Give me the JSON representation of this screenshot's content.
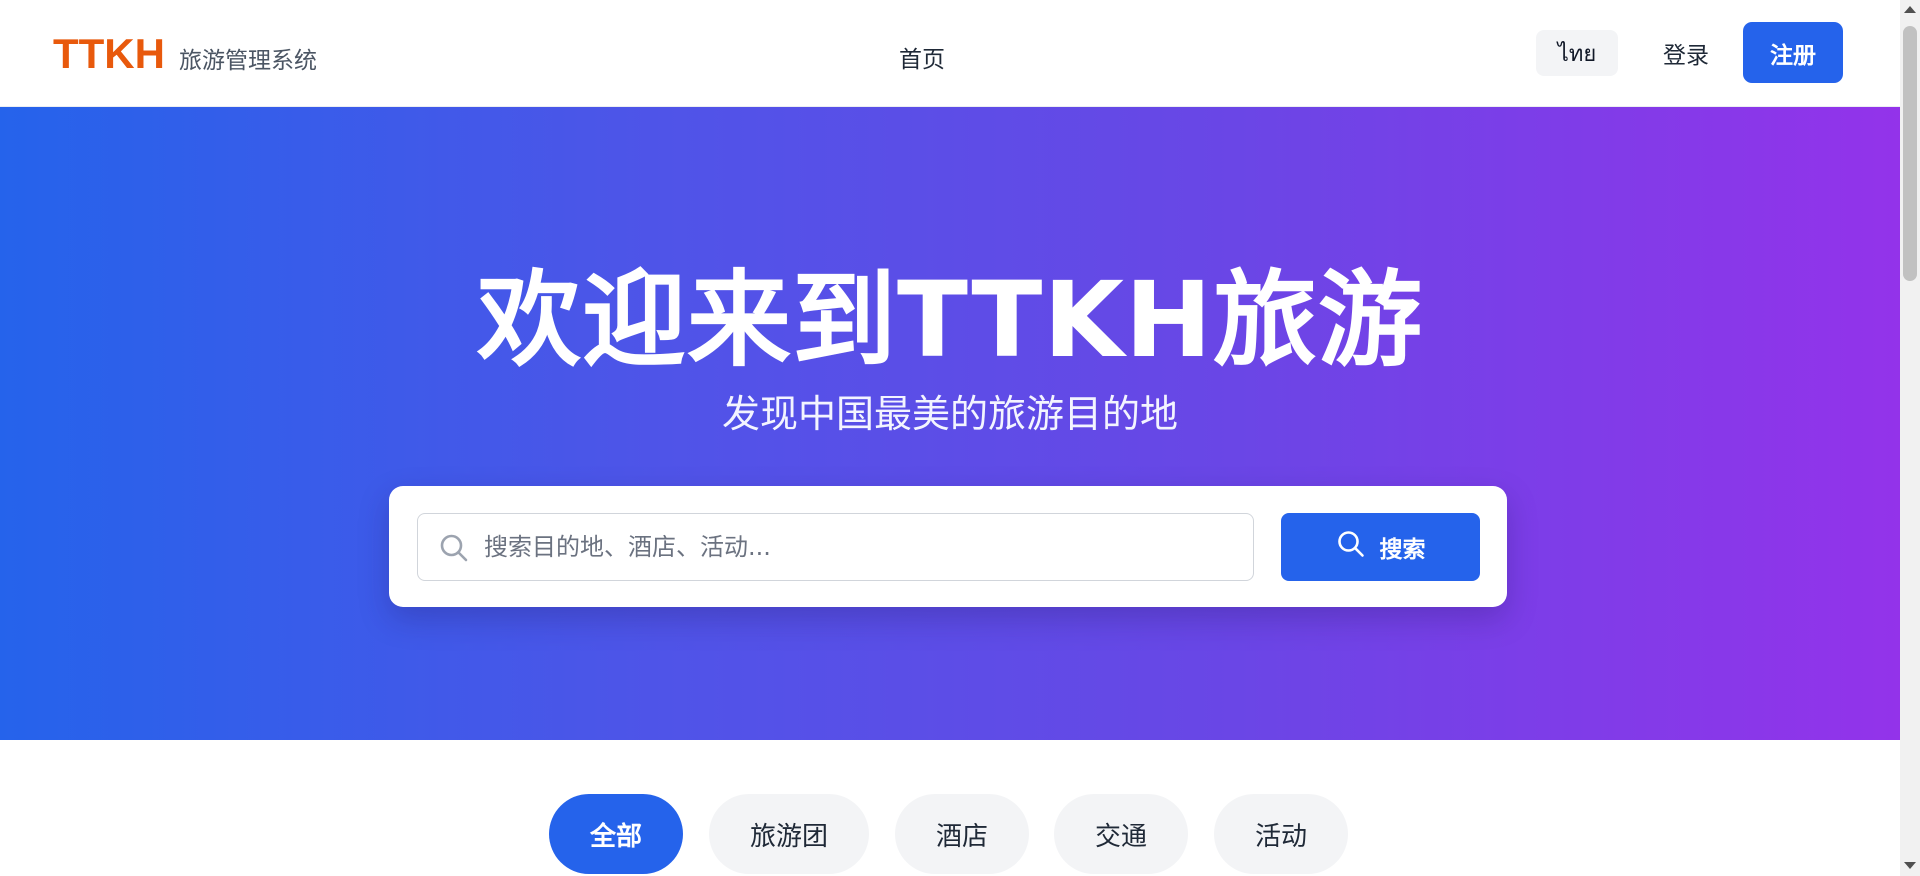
{
  "header": {
    "logo_text": "TTKH",
    "subtitle": "旅游管理系统",
    "nav_home": "首页",
    "lang_label": "ไทย",
    "login_label": "登录",
    "register_label": "注册"
  },
  "hero": {
    "title": "欢迎来到TTKH旅游",
    "subtitle": "发现中国最美的旅游目的地",
    "search": {
      "placeholder": "搜索目的地、酒店、活动...",
      "value": "",
      "button_label": "搜索"
    }
  },
  "categories": {
    "items": [
      {
        "label": "全部",
        "active": true
      },
      {
        "label": "旅游团",
        "active": false
      },
      {
        "label": "酒店",
        "active": false
      },
      {
        "label": "交通",
        "active": false
      },
      {
        "label": "活动",
        "active": false
      }
    ]
  },
  "colors": {
    "brand": "#e8590c",
    "primary": "#2563eb",
    "hero_gradient_start": "#2563eb",
    "hero_gradient_end": "#9333ea"
  },
  "icons": {
    "search_field": "search-icon",
    "search_button": "search-icon"
  }
}
